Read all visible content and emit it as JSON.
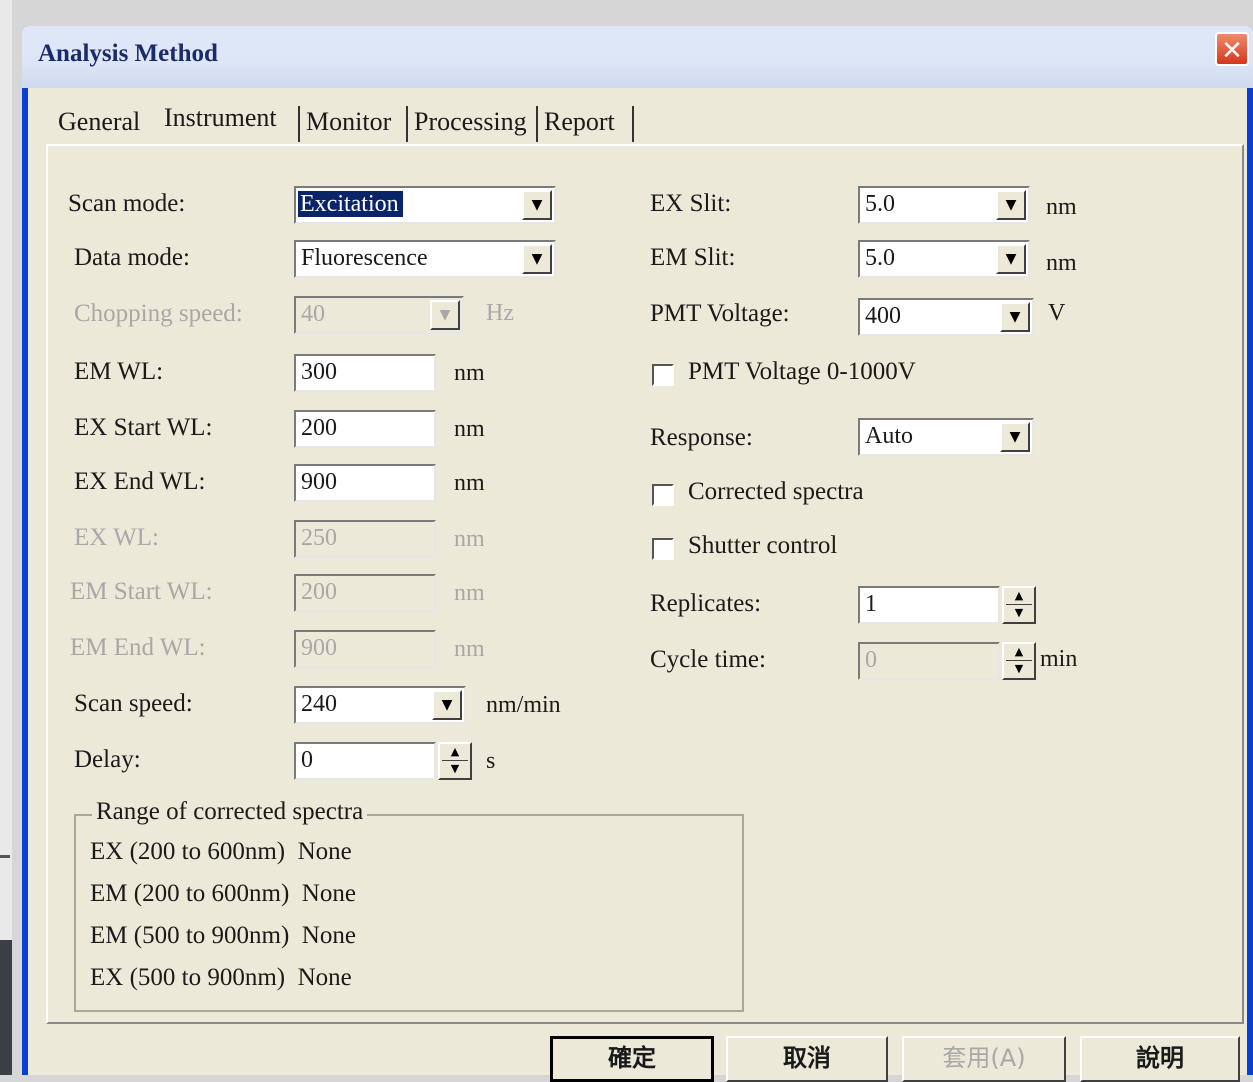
{
  "window": {
    "title": "Analysis Method",
    "close_glyph": "✕"
  },
  "tabs": [
    "General",
    "Instrument",
    "Monitor",
    "Processing",
    "Report"
  ],
  "active_tab": "Instrument",
  "left": {
    "scan_mode": {
      "label": "Scan mode:",
      "value": "Excitation"
    },
    "data_mode": {
      "label": "Data mode:",
      "value": "Fluorescence"
    },
    "chopping_speed": {
      "label": "Chopping speed:",
      "value": "40",
      "unit": "Hz"
    },
    "em_wl": {
      "label": "EM WL:",
      "value": "300",
      "unit": "nm"
    },
    "ex_start_wl": {
      "label": "EX Start WL:",
      "value": "200",
      "unit": "nm"
    },
    "ex_end_wl": {
      "label": "EX End WL:",
      "value": "900",
      "unit": "nm"
    },
    "ex_wl": {
      "label": "EX WL:",
      "value": "250",
      "unit": "nm"
    },
    "em_start_wl": {
      "label": "EM Start WL:",
      "value": "200",
      "unit": "nm"
    },
    "em_end_wl": {
      "label": "EM End WL:",
      "value": "900",
      "unit": "nm"
    },
    "scan_speed": {
      "label": "Scan speed:",
      "value": "240",
      "unit": "nm/min"
    },
    "delay": {
      "label": "Delay:",
      "value": "0",
      "unit": "s"
    }
  },
  "right": {
    "ex_slit": {
      "label": "EX Slit:",
      "value": "5.0",
      "unit": "nm"
    },
    "em_slit": {
      "label": "EM Slit:",
      "value": "5.0",
      "unit": "nm"
    },
    "pmt_voltage": {
      "label": "PMT Voltage:",
      "value": "400",
      "unit": "V"
    },
    "pmt_voltage_range": {
      "label": "PMT Voltage 0-1000V",
      "checked": false
    },
    "response": {
      "label": "Response:",
      "value": "Auto"
    },
    "corrected_spectra": {
      "label": "Corrected spectra",
      "checked": false
    },
    "shutter_control": {
      "label": "Shutter control",
      "checked": false
    },
    "replicates": {
      "label": "Replicates:",
      "value": "1"
    },
    "cycle_time": {
      "label": "Cycle time:",
      "value": "0",
      "unit": "min"
    }
  },
  "range_group": {
    "title": "Range of corrected spectra",
    "rows": [
      "EX (200 to 600nm)  None",
      "EM (200 to 600nm)  None",
      "EM (500 to 900nm)  None",
      "EX (500 to 900nm)  None"
    ]
  },
  "buttons": {
    "ok": "確定",
    "cancel": "取消",
    "apply": "套用(A)",
    "help": "說明"
  },
  "icons": {
    "dropdown": "▼",
    "spin_up": "▲",
    "spin_down": "▼"
  },
  "colors": {
    "title_bar": "#dfe7f7",
    "selection": "#0a246a",
    "close": "#d6371c",
    "face": "#ece9d8"
  }
}
